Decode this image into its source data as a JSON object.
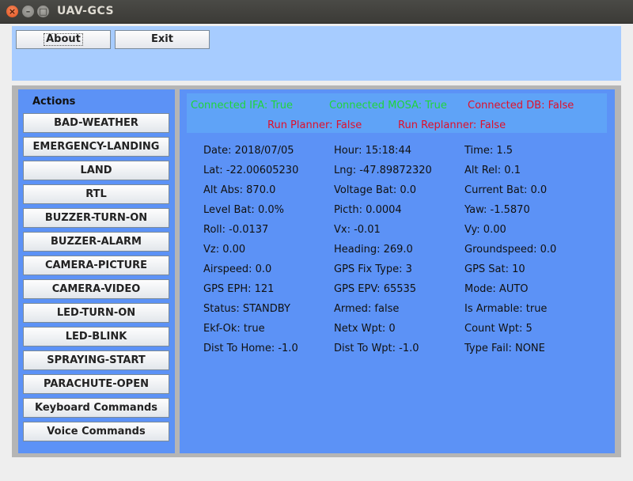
{
  "window": {
    "title": "UAV-GCS"
  },
  "toolbar": {
    "about_label": "About",
    "exit_label": "Exit"
  },
  "actions": {
    "title": "Actions",
    "buttons": [
      "BAD-WEATHER",
      "EMERGENCY-LANDING",
      "LAND",
      "RTL",
      "BUZZER-TURN-ON",
      "BUZZER-ALARM",
      "CAMERA-PICTURE",
      "CAMERA-VIDEO",
      "LED-TURN-ON",
      "LED-BLINK",
      "SPRAYING-START",
      "PARACHUTE-OPEN",
      "Keyboard Commands",
      "Voice Commands"
    ]
  },
  "status": {
    "connected_ifa": "Connected IFA: True",
    "connected_mosa": "Connected MOSA: True",
    "connected_db": "Connected DB: False",
    "run_planner": "Run Planner: False",
    "run_replanner": "Run Replanner: False",
    "colors": {
      "true": "#1fd53b",
      "false": "#e0102a"
    }
  },
  "telemetry": [
    [
      "Date: 2018/07/05",
      "Hour: 15:18:44",
      "Time: 1.5"
    ],
    [
      "Lat: -22.00605230",
      "Lng: -47.89872320",
      "Alt Rel: 0.1"
    ],
    [
      "Alt Abs: 870.0",
      "Voltage Bat: 0.0",
      "Current Bat: 0.0"
    ],
    [
      "Level Bat: 0.0%",
      "Picth: 0.0004",
      "Yaw: -1.5870"
    ],
    [
      "Roll: -0.0137",
      "Vx: -0.01",
      "Vy: 0.00"
    ],
    [
      "Vz: 0.00",
      "Heading: 269.0",
      "Groundspeed: 0.0"
    ],
    [
      "Airspeed: 0.0",
      "GPS Fix Type: 3",
      "GPS Sat: 10"
    ],
    [
      "GPS EPH: 121",
      "GPS EPV: 65535",
      "Mode: AUTO"
    ],
    [
      "Status: STANDBY",
      "Armed: false",
      "Is Armable: true"
    ],
    [
      "Ekf-Ok: true",
      "Netx Wpt: 0",
      "Count Wpt: 5"
    ],
    [
      "Dist To Home: -1.0",
      "Dist To Wpt: -1.0",
      "Type Fail: NONE"
    ]
  ]
}
